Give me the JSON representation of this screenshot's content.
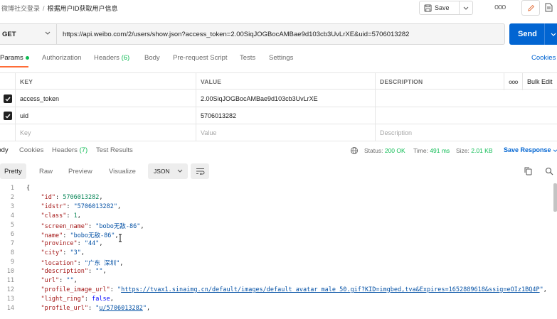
{
  "breadcrumb": {
    "collection": "微博社交登录",
    "separator": "/",
    "request": "根据用户ID获取用户信息"
  },
  "toolbar": {
    "save_label": "Save",
    "more": "ooo"
  },
  "request": {
    "method": "GET",
    "url": "https://api.weibo.com/2/users/show.json?access_token=2.00SiqJOGBocAMBae9d103cb3UvLrXE&uid=5706013282",
    "send_label": "Send"
  },
  "request_tabs": [
    {
      "label": "Params",
      "active": true
    },
    {
      "label": "Authorization"
    },
    {
      "label": "Headers",
      "count": "(6)"
    },
    {
      "label": "Body"
    },
    {
      "label": "Pre-request Script"
    },
    {
      "label": "Tests"
    },
    {
      "label": "Settings"
    }
  ],
  "cookies_label": "Cookies",
  "params": {
    "headers": {
      "key": "KEY",
      "value": "VALUE",
      "description": "DESCRIPTION",
      "more": "ooo",
      "bulk_edit": "Bulk Edit"
    },
    "rows": [
      {
        "checked": true,
        "key": "access_token",
        "value": "2.00SiqJOGBocAMBae9d103cb3UvLrXE",
        "description": ""
      },
      {
        "checked": true,
        "key": "uid",
        "value": "5706013282",
        "description": ""
      }
    ],
    "placeholder": {
      "key": "Key",
      "value": "Value",
      "description": "Description"
    }
  },
  "response_tabs": [
    {
      "label": "Body",
      "active": true
    },
    {
      "label": "Cookies"
    },
    {
      "label": "Headers",
      "count": "(7)"
    },
    {
      "label": "Test Results"
    }
  ],
  "response_meta": {
    "status_label": "Status:",
    "status": "200 OK",
    "time_label": "Time:",
    "time": "491 ms",
    "size_label": "Size:",
    "size": "2.01 KB",
    "save_response": "Save Response"
  },
  "view_modes": [
    "Pretty",
    "Raw",
    "Preview",
    "Visualize"
  ],
  "active_view": "Pretty",
  "format": "JSON",
  "code_lines": [
    {
      "n": "1",
      "text": "{"
    },
    {
      "n": "2",
      "text": "    \"id\": 5706013282,"
    },
    {
      "n": "3",
      "text": "    \"idstr\": \"5706013282\","
    },
    {
      "n": "4",
      "text": "    \"class\": 1,"
    },
    {
      "n": "5",
      "text": "    \"screen_name\": \"bobo无敌-86\","
    },
    {
      "n": "6",
      "text": "    \"name\": \"bobo无敌-86\","
    },
    {
      "n": "7",
      "text": "    \"province\": \"44\","
    },
    {
      "n": "8",
      "text": "    \"city\": \"3\","
    },
    {
      "n": "9",
      "text": "    \"location\": \"广东 深圳\","
    },
    {
      "n": "10",
      "text": "    \"description\": \"\","
    },
    {
      "n": "11",
      "text": "    \"url\": \"\","
    },
    {
      "n": "12",
      "text": "    \"profile_image_url\": \"https://tvax1.sinaimg.cn/default/images/default_avatar_male_50.gif?KID=imgbed,tva&Expires=1652889618&ssig=eOIz1BQ4P\","
    },
    {
      "n": "13",
      "text": "    \"light_ring\": false,"
    },
    {
      "n": "14",
      "text": "    \"profile_url\": \"u/5706013282\","
    }
  ],
  "icons": {
    "save": "save-icon",
    "chevron": "chevron-down-icon",
    "edit": "pencil-icon",
    "doc": "document-icon",
    "wrap": "wrap-lines-icon",
    "copy": "copy-icon",
    "search": "search-icon",
    "network": "globe-network-icon"
  },
  "colors": {
    "accent": "#ff6c37",
    "send": "#0265d2",
    "success": "#0cbb52",
    "link": "#0265d2"
  }
}
